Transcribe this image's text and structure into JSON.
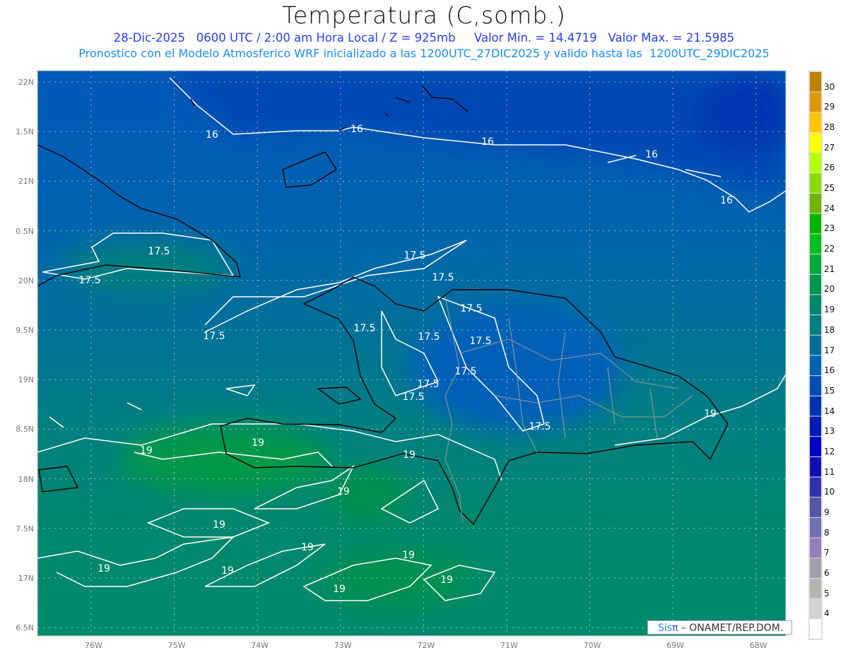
{
  "header": {
    "title": "Temperatura (C,somb.)",
    "line1": "28-Dic-2025   0600 UTC / 2:00 am Hora Local / Z = 925mb     Valor Min. = 14.4719   Valor Max. = 21.5985",
    "line2": "Pronostico con el Modelo Atmosferico WRF inicializado a las 1200UTC_27DIC2025 y valido hasta las  1200UTC_29DIC2025"
  },
  "axes": {
    "lat_labels": [
      "22N",
      "1.5N",
      "21N",
      "0.5N",
      "20N",
      "9.5N",
      "19N",
      "8.5N",
      "18N",
      "7.5N",
      "17N",
      "6.5N"
    ],
    "lon_labels": [
      "76W",
      "75W",
      "74W",
      "73W",
      "72W",
      "71W",
      "70W",
      "69W",
      "68W"
    ]
  },
  "colorbar": {
    "labels": [
      "30",
      "29",
      "28",
      "27",
      "26",
      "25",
      "24",
      "23",
      "22",
      "21",
      "20",
      "19",
      "18",
      "17",
      "16",
      "15",
      "14",
      "13",
      "12",
      "11",
      "10",
      "9",
      "8",
      "7",
      "6",
      "5",
      "4"
    ],
    "colors": [
      "#c08000",
      "#e09800",
      "#ffc400",
      "#ffff00",
      "#b4ff00",
      "#8cdc00",
      "#6eb400",
      "#00b400",
      "#00be1e",
      "#00aa3c",
      "#009650",
      "#00876e",
      "#008080",
      "#006e9a",
      "#0064b4",
      "#0050b4",
      "#0032b4",
      "#001eb4",
      "#0000c8",
      "#1010b0",
      "#3232b0",
      "#5555aa",
      "#7070b0",
      "#9080b8",
      "#a0a0aa",
      "#b4b4b4",
      "#d2d2d2",
      "#ffffff"
    ]
  },
  "contours": {
    "labels": [
      "16",
      "16",
      "16",
      "16",
      "16",
      "17.5",
      "17.5",
      "17.5",
      "17.5",
      "17.5",
      "17.5",
      "17.5",
      "17.5",
      "17.5",
      "17.5",
      "17.5",
      "17.5",
      "17.5",
      "19",
      "19",
      "19",
      "19",
      "19",
      "19",
      "19",
      "19",
      "19",
      "19",
      "19",
      "19"
    ]
  },
  "credit": {
    "sis": "Sis",
    "pi": "π",
    "text": " –  ONAMET/REP.DOM."
  }
}
